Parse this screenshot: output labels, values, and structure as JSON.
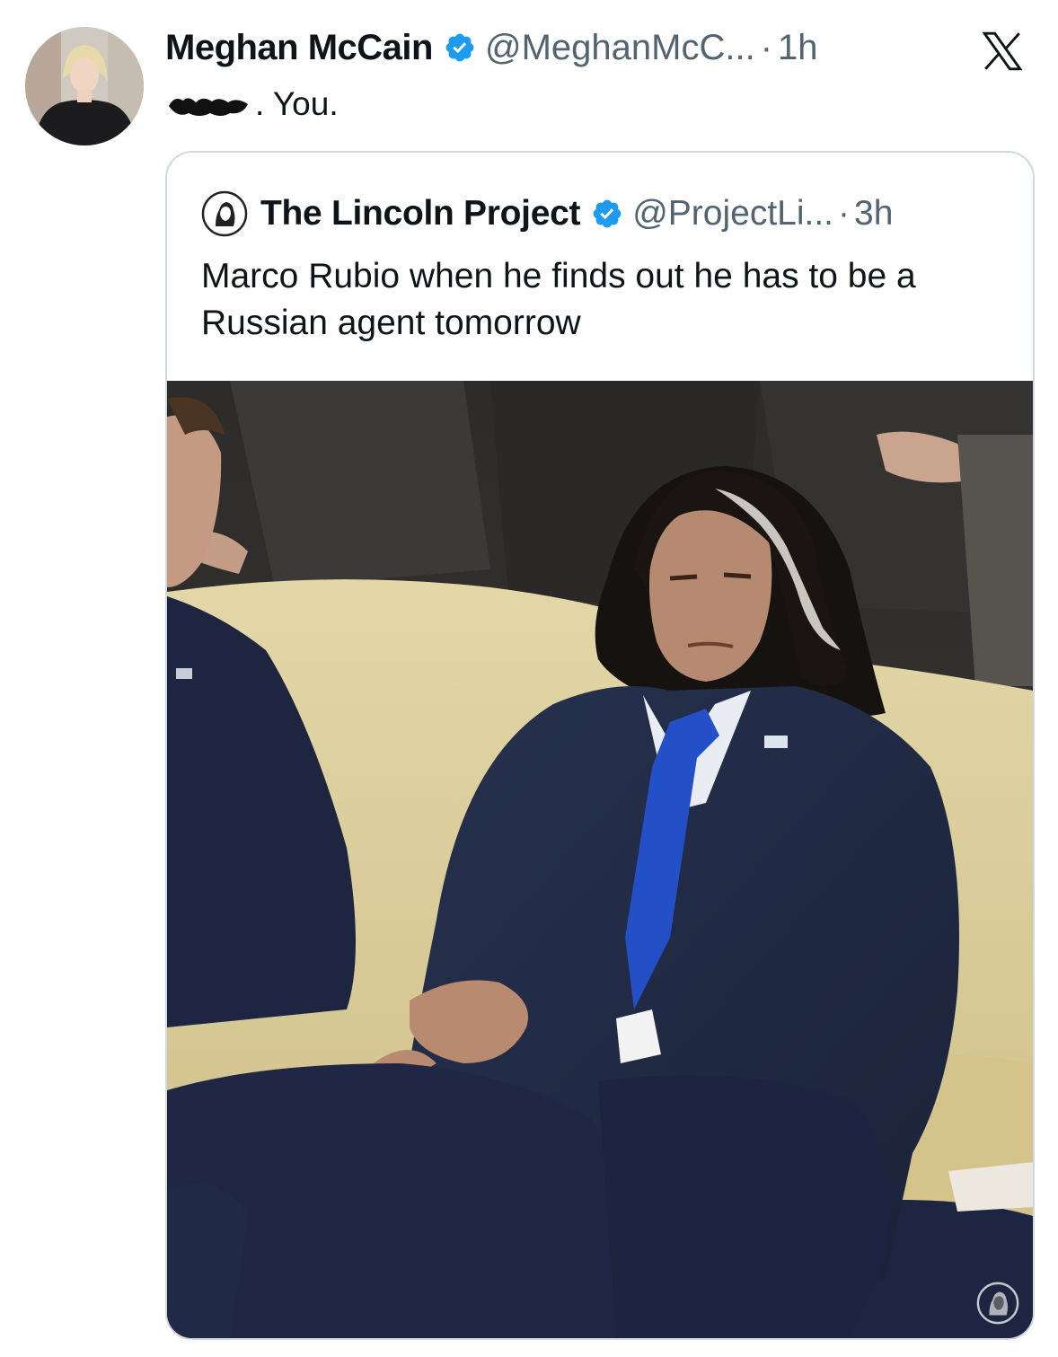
{
  "tweet": {
    "author_name": "Meghan McCain",
    "author_handle": "@MeghanMcC...",
    "separator": "·",
    "time": "1h",
    "censored_word_icon": "redacted-scribble",
    "text_suffix": ". You.",
    "verified_color": "#1d9bf0",
    "platform_icon": "x-logo-icon"
  },
  "quote": {
    "author_name": "The Lincoln Project",
    "author_handle": "@ProjectLi...",
    "separator": "·",
    "time": "3h",
    "text": "Marco Rubio when he finds out he has to be a Russian agent tomorrow",
    "media_description_icon": "photo-man-on-sofa",
    "watermark_icon": "lincoln-portrait-icon"
  }
}
